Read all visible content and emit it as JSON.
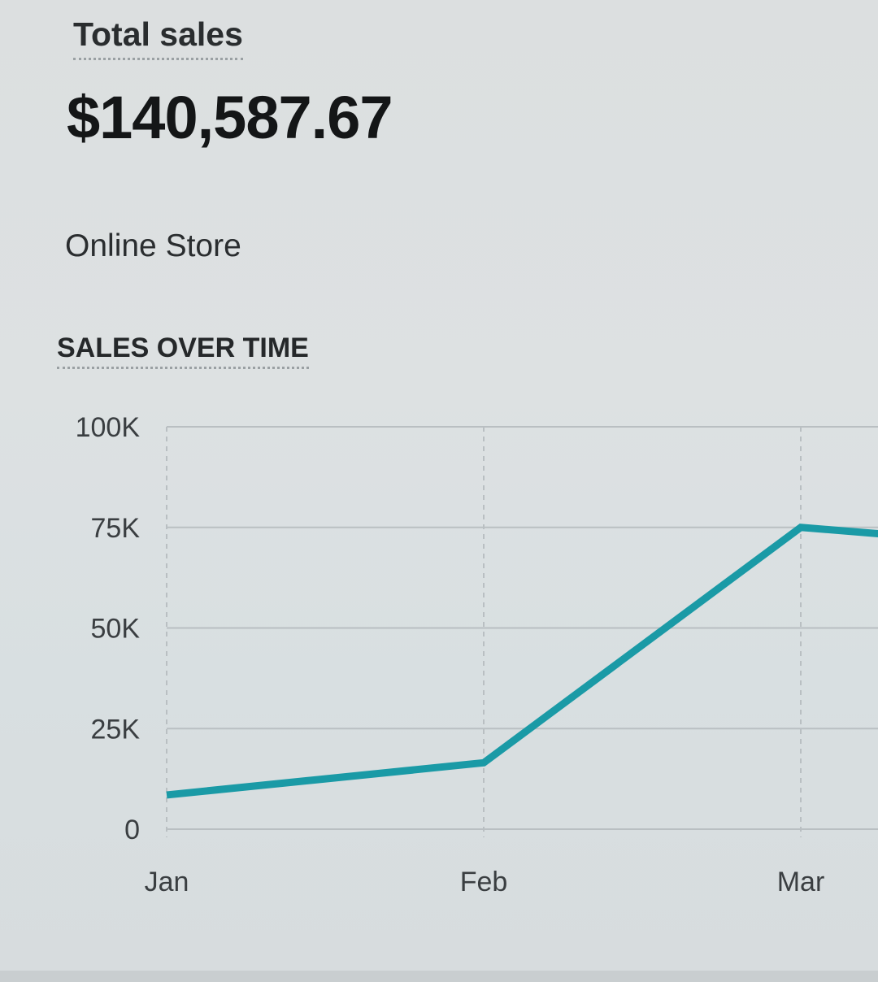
{
  "summary": {
    "total_label": "Total sales",
    "total_value": "$140,587.67",
    "channel": "Online Store",
    "section_title": "SALES OVER TIME"
  },
  "colors": {
    "line": "#1a9aa6",
    "grid": "#b9bfc2"
  },
  "chart_data": {
    "type": "line",
    "title": "SALES OVER TIME",
    "categories": [
      "Jan",
      "Feb",
      "Mar"
    ],
    "series": [
      {
        "values": [
          8500,
          16500,
          75000
        ]
      }
    ],
    "trailing_point": {
      "x_position": 3.25,
      "value": 67000
    },
    "yticks": [
      "0",
      "25K",
      "50K",
      "75K",
      "100K"
    ],
    "ytick_values": [
      0,
      25000,
      50000,
      75000,
      100000
    ],
    "ylim": [
      0,
      100000
    ],
    "grid": true,
    "xlabel": "",
    "ylabel": ""
  }
}
